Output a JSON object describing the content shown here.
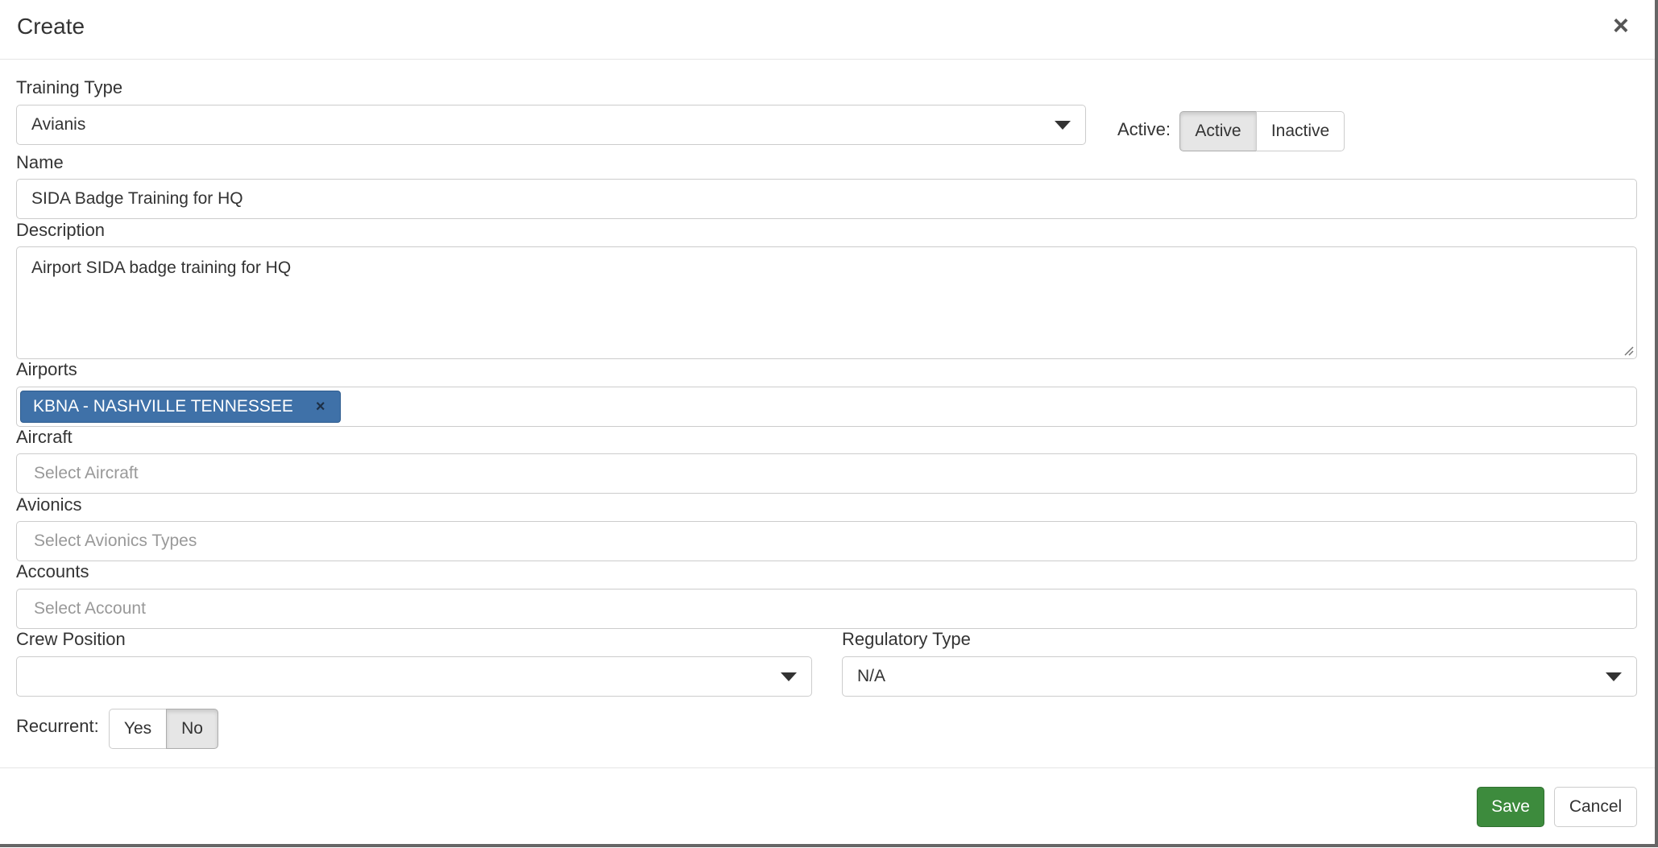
{
  "header": {
    "title": "Create",
    "close_label": "×"
  },
  "training_type": {
    "label": "Training Type",
    "value": "Avianis"
  },
  "active": {
    "label": "Active:",
    "options": [
      "Active",
      "Inactive"
    ],
    "selected": "Active"
  },
  "name": {
    "label": "Name",
    "value": "SIDA Badge Training for HQ"
  },
  "description": {
    "label": "Description",
    "value": "Airport SIDA badge training for HQ"
  },
  "airports": {
    "label": "Airports",
    "tags": [
      {
        "text": "KBNA - NASHVILLE TENNESSEE",
        "remove": "×"
      }
    ]
  },
  "aircraft": {
    "label": "Aircraft",
    "placeholder": "Select Aircraft"
  },
  "avionics": {
    "label": "Avionics",
    "placeholder": "Select Avionics Types"
  },
  "accounts": {
    "label": "Accounts",
    "placeholder": "Select Account"
  },
  "crew_position": {
    "label": "Crew Position",
    "value": ""
  },
  "regulatory_type": {
    "label": "Regulatory Type",
    "value": "N/A"
  },
  "recurrent": {
    "label": "Recurrent:",
    "options": [
      "Yes",
      "No"
    ],
    "selected": "No"
  },
  "footer": {
    "save_label": "Save",
    "cancel_label": "Cancel"
  },
  "colors": {
    "save_green": "#3d8b3d",
    "tag_blue": "#3f71a8"
  }
}
